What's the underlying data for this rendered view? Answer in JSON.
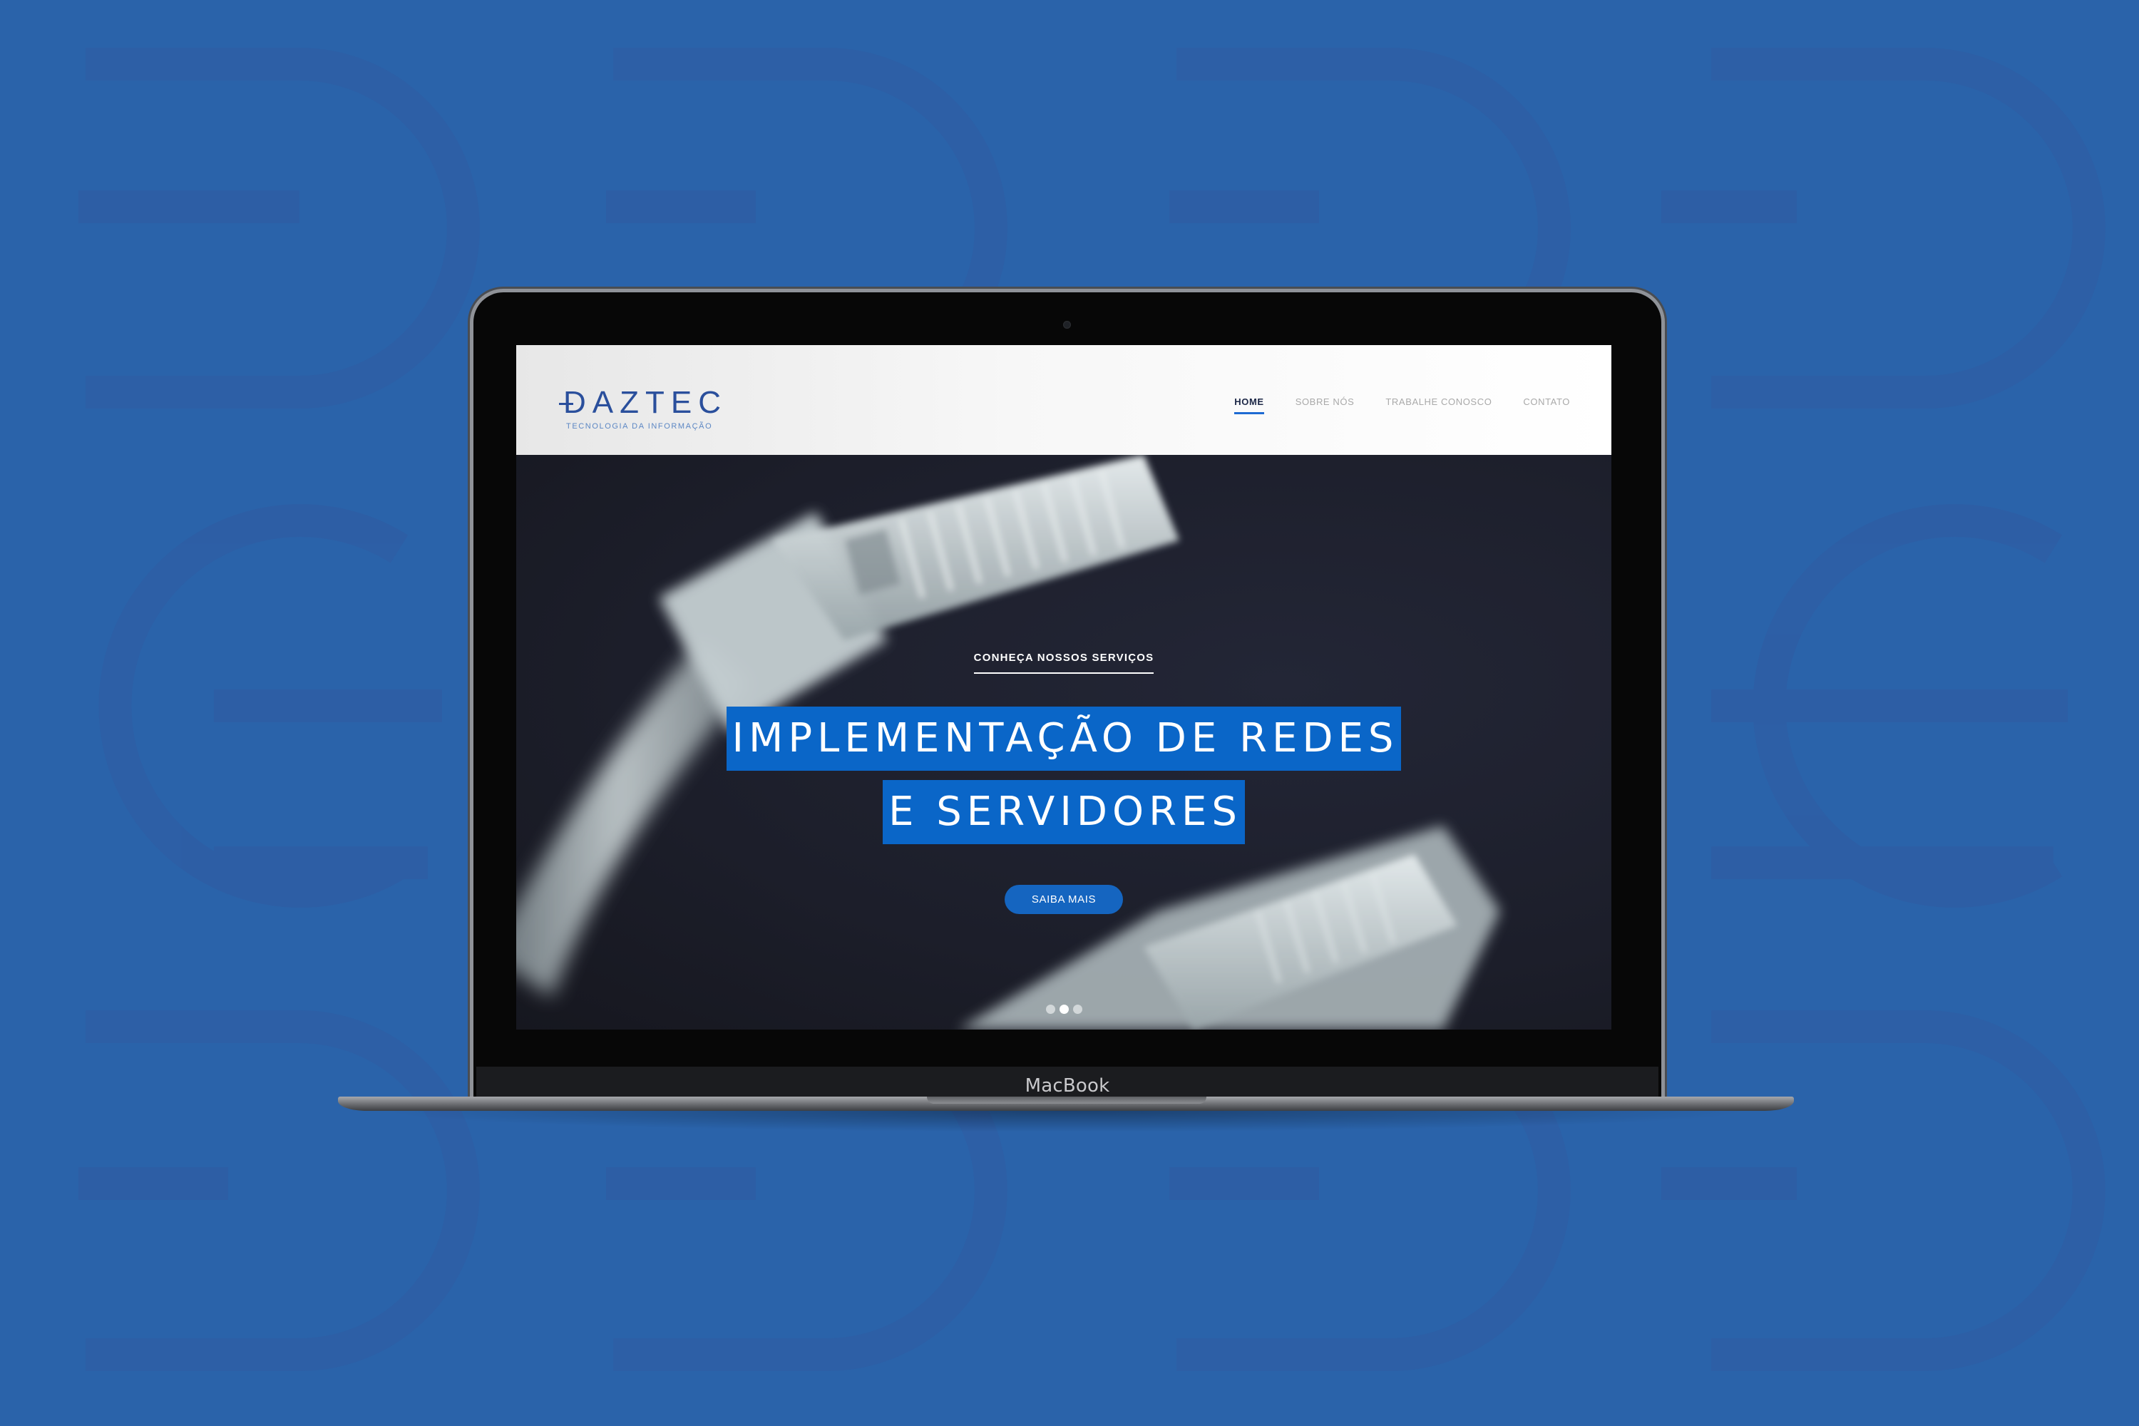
{
  "colors": {
    "background": "#2a63aa",
    "accent": "#0a66c8",
    "button": "#1565c0",
    "logo": "#2a4f9c"
  },
  "device": {
    "label": "MacBook"
  },
  "site": {
    "logo": {
      "wordmark": "DAZTEC",
      "tagline": "TECNOLOGIA DA INFORMAÇÃO"
    },
    "nav": [
      {
        "label": "HOME",
        "active": true
      },
      {
        "label": "SOBRE NÓS",
        "active": false
      },
      {
        "label": "TRABALHE CONOSCO",
        "active": false
      },
      {
        "label": "CONTATO",
        "active": false
      }
    ],
    "hero": {
      "eyebrow": "CONHEÇA NOSSOS SERVIÇOS",
      "title_line1": "IMPLEMENTAÇÃO DE REDES",
      "title_line2": "E SERVIDORES",
      "cta": "SAIBA MAIS",
      "slides_total": 3,
      "active_slide": 2
    }
  },
  "icons": {
    "background_pattern": "daztec-logo-pattern-icon",
    "hero_image": "ethernet-cable-connector-icon"
  }
}
